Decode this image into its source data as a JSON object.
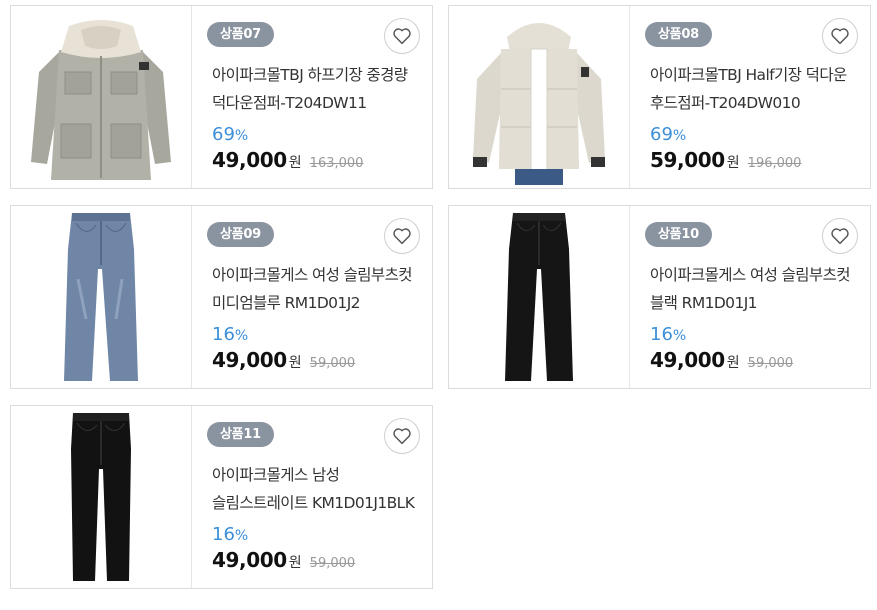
{
  "icons": {
    "wishlist": "heart-outline-icon"
  },
  "colors": {
    "badge": "#8a93a0",
    "discount": "#3d8fd8",
    "price": "#111111"
  },
  "products": [
    {
      "badge": "상품07",
      "title": "아이파크몰TBJ 하프기장 중경량 덕다운점퍼-T204DW11",
      "discount": "69",
      "discount_unit": "%",
      "price": "49,000",
      "price_unit": "원",
      "original_price": "163,000",
      "image": "gray parka with shearling collar"
    },
    {
      "badge": "상품08",
      "title": "아이파크몰TBJ Half기장 덕다운 후드점퍼-T204DW010",
      "discount": "69",
      "discount_unit": "%",
      "price": "59,000",
      "price_unit": "원",
      "original_price": "196,000",
      "image": "beige hooded down jacket"
    },
    {
      "badge": "상품09",
      "title": "아이파크몰게스 여성 슬림부츠컷 미디엄블루 RM1D01J2",
      "discount": "16",
      "discount_unit": "%",
      "price": "49,000",
      "price_unit": "원",
      "original_price": "59,000",
      "image": "medium blue bootcut jeans"
    },
    {
      "badge": "상품10",
      "title": "아이파크몰게스 여성 슬림부츠컷 블랙 RM1D01J1",
      "discount": "16",
      "discount_unit": "%",
      "price": "49,000",
      "price_unit": "원",
      "original_price": "59,000",
      "image": "black bootcut jeans"
    },
    {
      "badge": "상품11",
      "title": "아이파크몰게스 남성 슬림스트레이트 KM1D01J1BLK",
      "discount": "16",
      "discount_unit": "%",
      "price": "49,000",
      "price_unit": "원",
      "original_price": "59,000",
      "image": "black slim straight jeans"
    }
  ]
}
